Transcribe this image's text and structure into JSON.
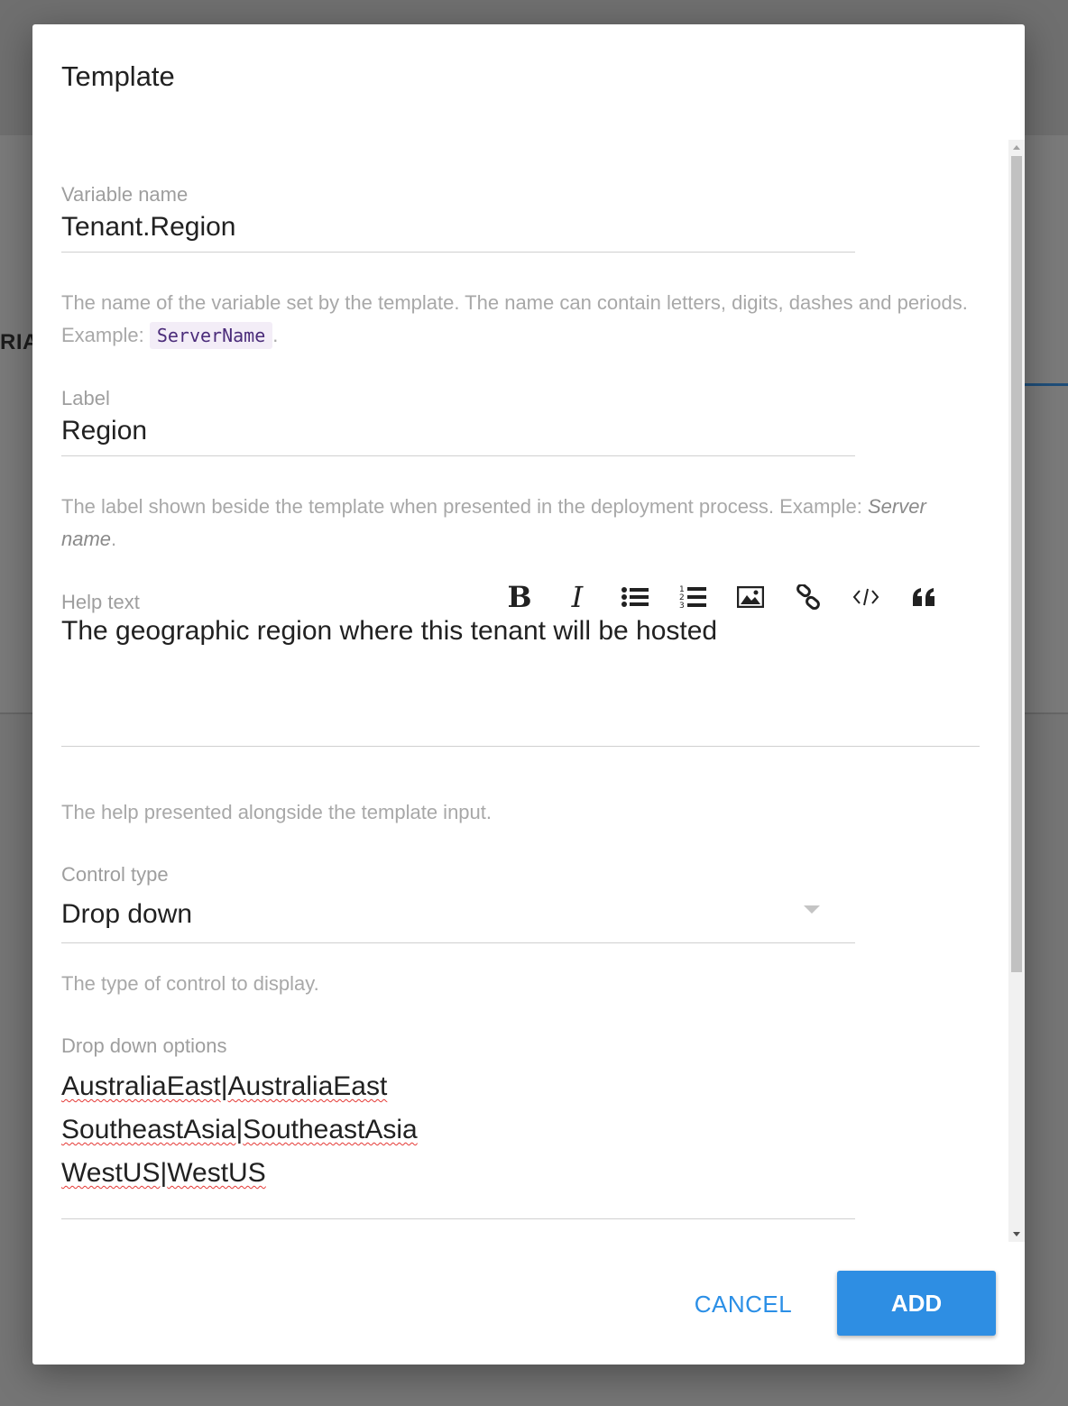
{
  "background": {
    "partial_text": "RIA"
  },
  "dialog": {
    "title": "Template",
    "variable_name": {
      "label": "Variable name",
      "value": "Tenant.Region",
      "helper_text": "The name of the variable set by the template. The name can contain letters, digits, dashes and periods. Example: ",
      "helper_code": "ServerName",
      "helper_suffix": "."
    },
    "label_field": {
      "label": "Label",
      "value": "Region",
      "helper_text": "The label shown beside the template when presented in the deployment process. Example: ",
      "helper_example": "Server name",
      "helper_suffix": "."
    },
    "help_text": {
      "label": "Help text",
      "value": "The geographic region where this tenant will be hosted",
      "helper_text": "The help presented alongside the template input.",
      "toolbar": {
        "bold": "B",
        "italic": "I",
        "icons": [
          "bold-icon",
          "italic-icon",
          "bullet-list-icon",
          "numbered-list-icon",
          "image-icon",
          "link-icon",
          "code-icon",
          "quote-icon"
        ]
      }
    },
    "control_type": {
      "label": "Control type",
      "value": "Drop down",
      "helper_text": "The type of control to display."
    },
    "dropdown_options": {
      "label": "Drop down options",
      "lines": [
        [
          "AustraliaEast",
          "AustraliaEast"
        ],
        [
          "SoutheastAsia",
          "SoutheastAsia"
        ],
        [
          "WestUS",
          "WestUS"
        ]
      ],
      "separator": "|"
    },
    "buttons": {
      "cancel": "CANCEL",
      "add": "ADD"
    },
    "colors": {
      "primary": "#2e8ee3",
      "link": "#2b8fe6",
      "spellcheck": "#e53935"
    }
  }
}
